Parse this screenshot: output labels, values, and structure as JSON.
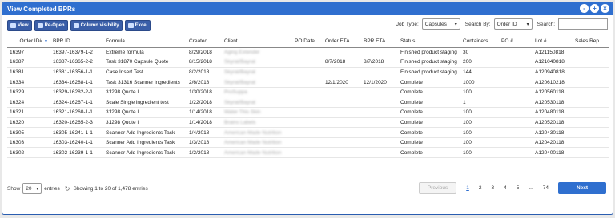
{
  "window": {
    "title": "View Completed BPRs",
    "controls": [
      "-",
      "+",
      "×"
    ]
  },
  "toolbar": {
    "buttons": [
      {
        "label": "View",
        "icon": "eye-icon"
      },
      {
        "label": "Re-Open",
        "icon": "reopen-icon"
      },
      {
        "label": "Column visibility",
        "icon": "columns-icon"
      },
      {
        "label": "Excel",
        "icon": "excel-icon"
      }
    ],
    "job_type_label": "Job Type:",
    "job_type_value": "Capsules",
    "search_by_label": "Search By:",
    "search_by_value": "Order ID",
    "search_label": "Search:",
    "search_value": ""
  },
  "table": {
    "columns": [
      "Order ID#",
      "BPR ID",
      "Formula",
      "Created",
      "Client",
      "PO Date",
      "Order ETA",
      "BPR ETA",
      "Status",
      "Containers",
      "PO #",
      "Lot #",
      "Sales Rep."
    ],
    "rows": [
      [
        "16397",
        "16397-16379-1-2",
        "Extreme formula",
        "8/29/2018",
        "Aging Extender",
        "",
        "",
        "",
        "Finished product staging",
        "30",
        "",
        "A121150818",
        ""
      ],
      [
        "16387",
        "16387-16365-2-2",
        "Task 31870 Capsule Quote",
        "8/15/2018",
        "Skyrat/Bayrat",
        "",
        "8/7/2018",
        "8/7/2018",
        "Finished product staging",
        "200",
        "",
        "A121040818",
        ""
      ],
      [
        "16381",
        "16381-16356-1-1",
        "Case Insert Test",
        "8/2/2018",
        "Skyrat/Bayrat",
        "",
        "",
        "",
        "Finished product staging",
        "144",
        "",
        "A120940818",
        ""
      ],
      [
        "16334",
        "16334-16288-1-1",
        "Task 31316 Scanner ingredients",
        "2/6/2018",
        "Skyrat/Bayrat",
        "",
        "12/1/2020",
        "12/1/2020",
        "Complete",
        "1000",
        "",
        "A120610218",
        ""
      ],
      [
        "16329",
        "16329-16282-2-1",
        "31298 Quote I",
        "1/30/2018",
        "ProSuppa",
        "",
        "",
        "",
        "Complete",
        "100",
        "",
        "A120560118",
        ""
      ],
      [
        "16324",
        "16324-16267-1-1",
        "Scale Single ingredient test",
        "1/22/2018",
        "Skyrat/Bayrat",
        "",
        "",
        "",
        "Complete",
        "1",
        "",
        "A120530118",
        ""
      ],
      [
        "16321",
        "16321-16260-1-1",
        "31298 Quote I",
        "1/14/2018",
        "Water This Skin",
        "",
        "",
        "",
        "Complete",
        "100",
        "",
        "A120480118",
        ""
      ],
      [
        "16320",
        "16320-16265-2-3",
        "31298 Quote I",
        "1/14/2018",
        "Brains Labels",
        "",
        "",
        "",
        "Complete",
        "100",
        "",
        "A120520118",
        ""
      ],
      [
        "16305",
        "16305-16241-1-1",
        "Scanner Add Ingredients Task",
        "1/4/2018",
        "American Made Nutrition",
        "",
        "",
        "",
        "Complete",
        "100",
        "",
        "A120430118",
        ""
      ],
      [
        "16303",
        "16303-16240-1-1",
        "Scanner Add Ingredients Task",
        "1/3/2018",
        "American Made Nutrition",
        "",
        "",
        "",
        "Complete",
        "100",
        "",
        "A120420118",
        ""
      ],
      [
        "16302",
        "16302-16239-1-1",
        "Scanner Add Ingredients Task",
        "1/2/2018",
        "American Made Nutrition",
        "",
        "",
        "",
        "Complete",
        "100",
        "",
        "A120400118",
        ""
      ]
    ]
  },
  "footer": {
    "show_label": "Show",
    "entries_value": "20",
    "entries_label": "entries",
    "info": "Showing 1 to 20 of 1,478 entries",
    "previous": "Previous",
    "pages": [
      "1",
      "2",
      "3",
      "4",
      "5",
      "...",
      "74"
    ],
    "next": "Next"
  },
  "colors": {
    "accent": "#2f6fcf",
    "toolbar_button": "#3a5ea8"
  }
}
